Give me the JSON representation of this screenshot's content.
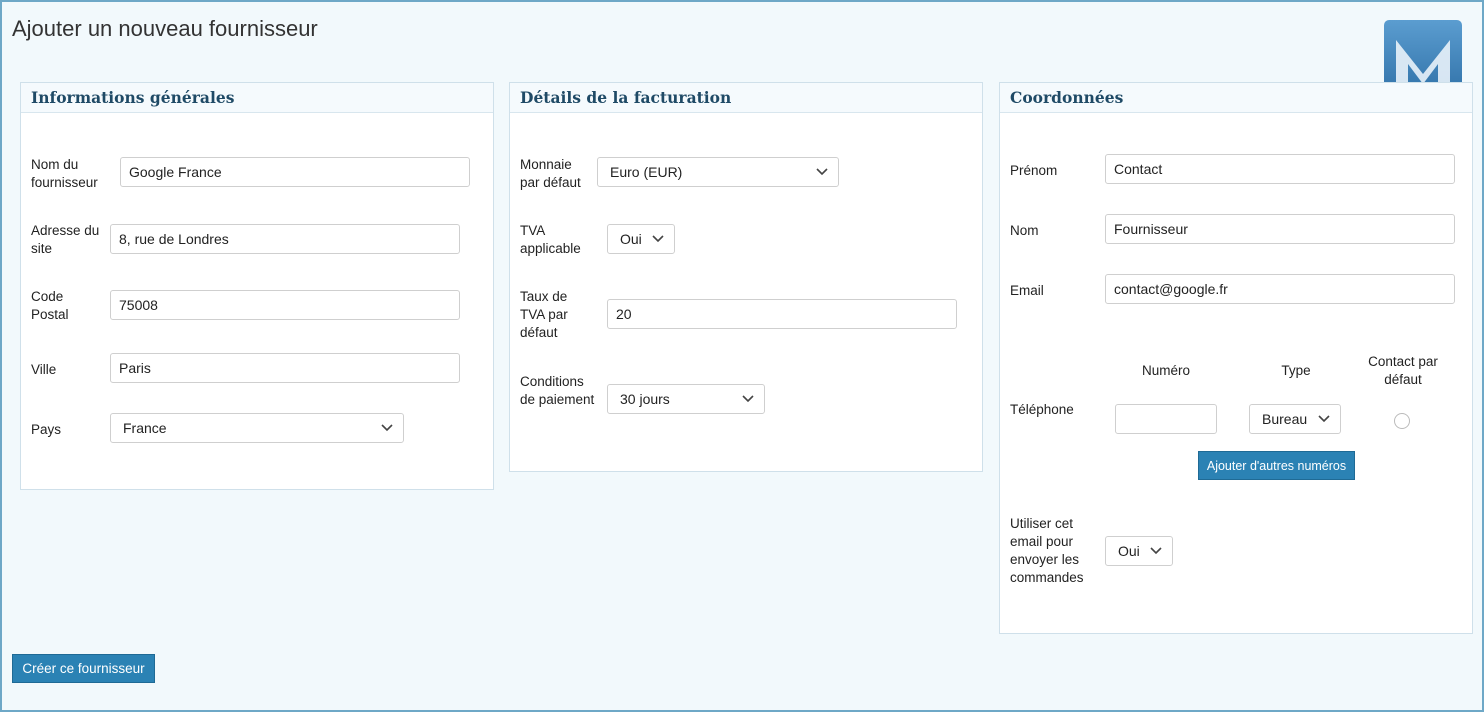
{
  "page": {
    "title": "Ajouter un nouveau fournisseur"
  },
  "general": {
    "title": "Informations générales",
    "name_label": "Nom du fournisseur",
    "name_value": "Google France",
    "address_label": "Adresse du site",
    "address_value": "8, rue de Londres",
    "postal_label": "Code Postal",
    "postal_value": "75008",
    "city_label": "Ville",
    "city_value": "Paris",
    "country_label": "Pays",
    "country_value": "France"
  },
  "billing": {
    "title": "Détails de la facturation",
    "currency_label": "Monnaie par défaut",
    "currency_value": "Euro (EUR)",
    "vat_label": "TVA applicable",
    "vat_value": "Oui",
    "vat_rate_label": "Taux de TVA par défaut",
    "vat_rate_value": "20",
    "terms_label": "Conditions de paiement",
    "terms_value": "30 jours"
  },
  "contact": {
    "title": "Coordonnées",
    "firstname_label": "Prénom",
    "firstname_value": "Contact",
    "lastname_label": "Nom",
    "lastname_value": "Fournisseur",
    "email_label": "Email",
    "email_value": "contact@google.fr",
    "phone_label": "Téléphone",
    "phone_col_number": "Numéro",
    "phone_col_type": "Type",
    "phone_col_default": "Contact par défaut",
    "phone_number_value": "",
    "phone_type_value": "Bureau",
    "add_numbers_label": "Ajouter d'autres numéros",
    "use_email_label": "Utiliser cet email pour envoyer les commandes",
    "use_email_value": "Oui"
  },
  "actions": {
    "create_label": "Créer ce fournisseur"
  },
  "colors": {
    "accent": "#2b82b4",
    "heading": "#1f4a66",
    "background": "#f2f9fc"
  },
  "icons": {
    "logo": "m-logo-icon",
    "dropdown": "chevron-down-icon"
  }
}
